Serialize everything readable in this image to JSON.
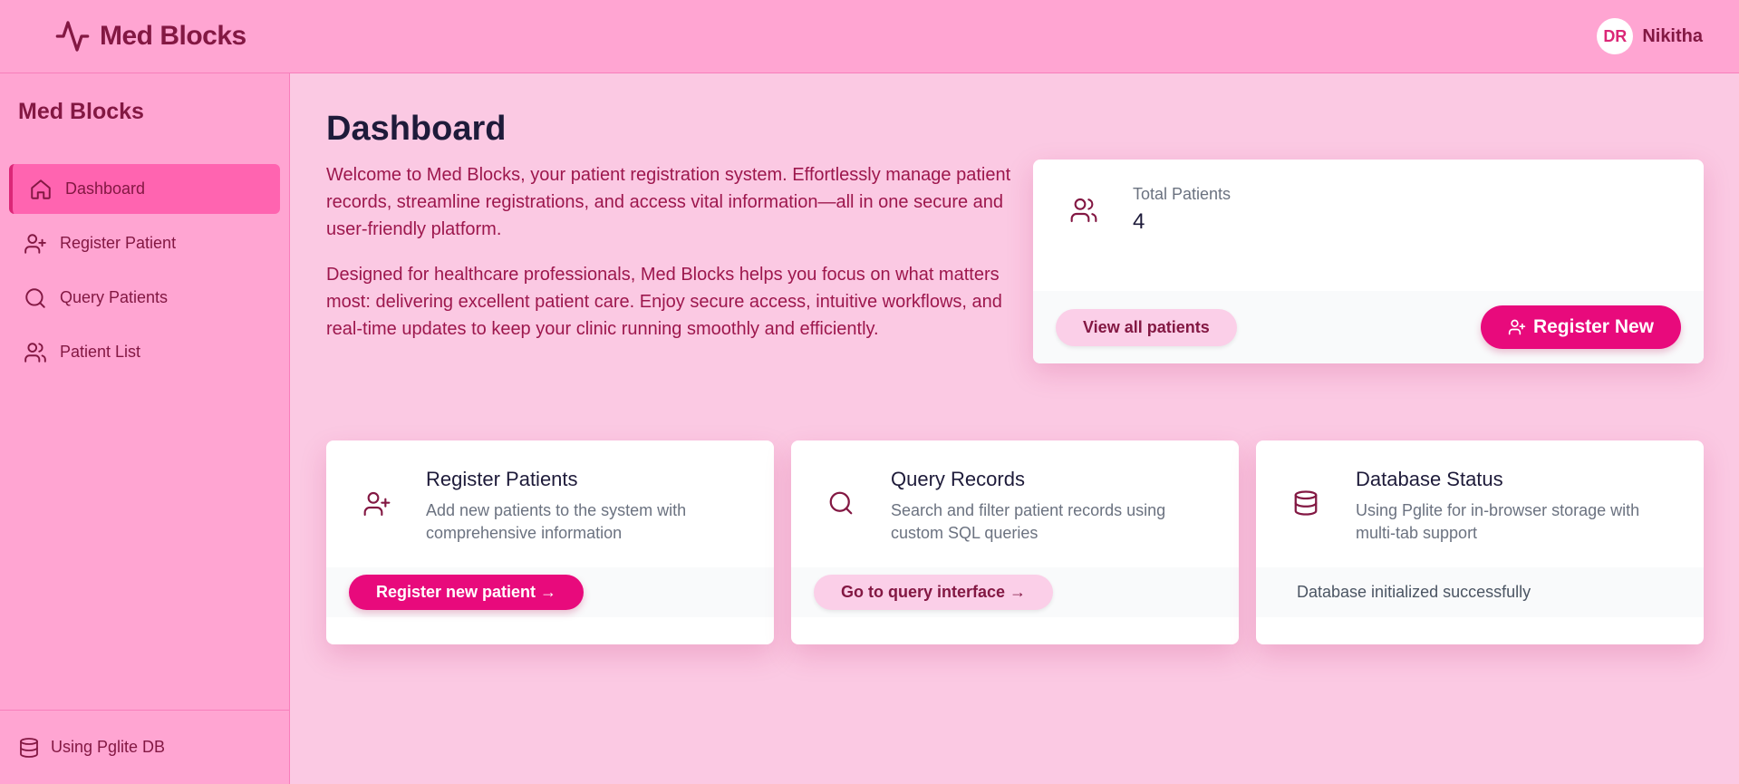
{
  "header": {
    "brand": "Med Blocks",
    "user_initials": "DR",
    "user_name": "Nikitha"
  },
  "sidebar": {
    "title": "Med Blocks",
    "items": [
      {
        "label": "Dashboard",
        "icon": "home-icon",
        "active": true
      },
      {
        "label": "Register Patient",
        "icon": "user-plus-icon",
        "active": false
      },
      {
        "label": "Query Patients",
        "icon": "search-icon",
        "active": false
      },
      {
        "label": "Patient List",
        "icon": "users-icon",
        "active": false
      }
    ],
    "footer": "Using Pglite DB"
  },
  "main": {
    "title": "Dashboard",
    "intro": [
      "Welcome to Med Blocks, your patient registration system. Effortlessly manage patient records, streamline registrations, and access vital information—all in one secure and user-friendly platform.",
      "Designed for healthcare professionals, Med Blocks helps you focus on what matters most: delivering excellent patient care. Enjoy secure access, intuitive workflows, and real-time updates to keep your clinic running smoothly and efficiently."
    ],
    "stats": {
      "label": "Total Patients",
      "value": "4",
      "view_all": "View all patients",
      "register_new": "Register New"
    },
    "features": [
      {
        "title": "Register Patients",
        "description": "Add new patients to the system with comprehensive information",
        "action": "Register new patient →"
      },
      {
        "title": "Query Records",
        "description": "Search and filter patient records using custom SQL queries",
        "action": "Go to query interface →"
      },
      {
        "title": "Database Status",
        "description": "Using Pglite for in-browser storage with multi-tab support",
        "status": "Database initialized successfully"
      }
    ]
  },
  "colors": {
    "accent": "#e80a7c",
    "header_bg": "#ffa5d2",
    "page_bg": "#fbc9e3",
    "text_dark": "#831843"
  }
}
